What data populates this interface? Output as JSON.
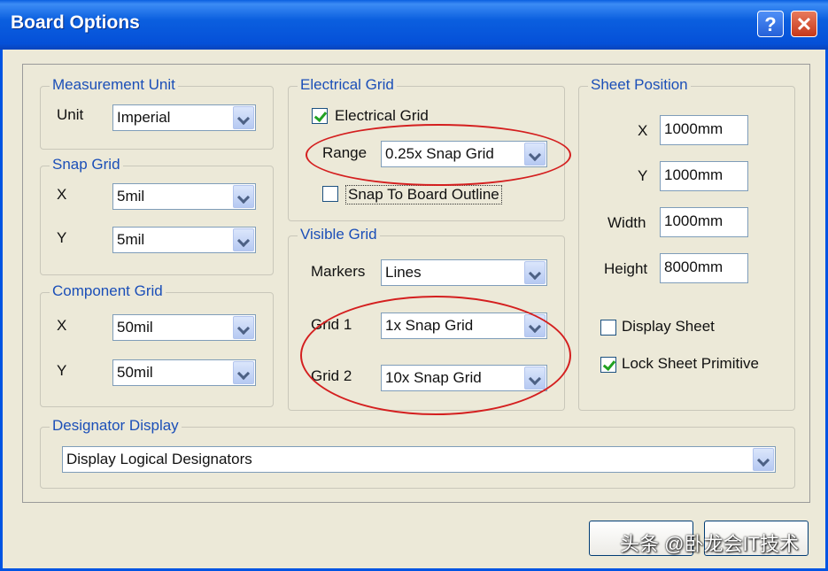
{
  "window": {
    "title": "Board Options",
    "help_label": "?",
    "close_label": "✕"
  },
  "measurement_unit": {
    "legend": "Measurement Unit",
    "unit_label": "Unit",
    "unit_value": "Imperial"
  },
  "snap_grid": {
    "legend": "Snap Grid",
    "x_label": "X",
    "x_value": "5mil",
    "y_label": "Y",
    "y_value": "5mil"
  },
  "component_grid": {
    "legend": "Component Grid",
    "x_label": "X",
    "x_value": "50mil",
    "y_label": "Y",
    "y_value": "50mil"
  },
  "electrical_grid": {
    "legend": "Electrical Grid",
    "checkbox_label": "Electrical Grid",
    "checked": true,
    "range_label": "Range",
    "range_value": "0.25x Snap Grid",
    "snap_outline_label": "Snap To Board Outline",
    "snap_outline_checked": false
  },
  "visible_grid": {
    "legend": "Visible Grid",
    "markers_label": "Markers",
    "markers_value": "Lines",
    "grid1_label": "Grid 1",
    "grid1_value": "1x Snap Grid",
    "grid2_label": "Grid 2",
    "grid2_value": "10x Snap Grid"
  },
  "sheet_position": {
    "legend": "Sheet Position",
    "x_label": "X",
    "x_value": "1000mm",
    "y_label": "Y",
    "y_value": "1000mm",
    "width_label": "Width",
    "width_value": "1000mm",
    "height_label": "Height",
    "height_value": "8000mm",
    "display_sheet_label": "Display Sheet",
    "display_sheet_checked": false,
    "lock_label": "Lock Sheet Primitive",
    "lock_checked": true
  },
  "designator_display": {
    "legend": "Designator Display",
    "value": "Display Logical Designators"
  },
  "watermark": "头条 @卧龙会IT技术",
  "colors": {
    "title_bar": "#0a5fe0",
    "annotation": "#d41f1f",
    "check": "#21a121"
  }
}
